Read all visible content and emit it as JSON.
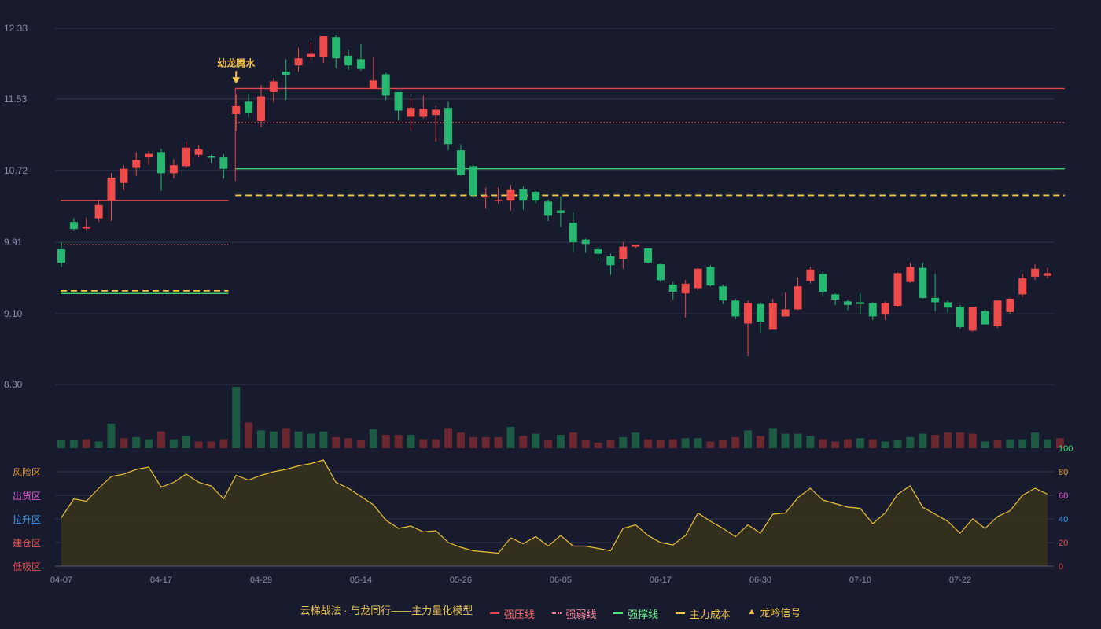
{
  "chart_data": {
    "type": "candlestick",
    "x_ticks": [
      "04-07",
      "04-17",
      "04-29",
      "05-14",
      "05-26",
      "06-05",
      "06-17",
      "06-30",
      "07-10",
      "07-22"
    ],
    "y_ticks": [
      "12.33",
      "11.53",
      "10.72",
      "9.91",
      "9.10",
      "8.30"
    ],
    "ylim": [
      8.3,
      12.33
    ],
    "candles": [
      [
        9.83,
        9.68,
        9.91,
        9.63
      ],
      [
        10.14,
        10.06,
        10.18,
        10.04
      ],
      [
        10.08,
        10.08,
        10.19,
        10.04
      ],
      [
        10.18,
        10.33,
        10.39,
        10.14
      ],
      [
        10.38,
        10.64,
        10.69,
        10.15
      ],
      [
        10.58,
        10.74,
        10.78,
        10.5
      ],
      [
        10.75,
        10.84,
        10.93,
        10.66
      ],
      [
        10.87,
        10.91,
        10.94,
        10.79
      ],
      [
        10.93,
        10.69,
        10.97,
        10.49
      ],
      [
        10.69,
        10.78,
        10.85,
        10.63
      ],
      [
        10.77,
        10.98,
        11.05,
        10.75
      ],
      [
        10.9,
        10.96,
        11.01,
        10.87
      ],
      [
        10.88,
        10.87,
        10.9,
        10.81
      ],
      [
        10.87,
        10.74,
        10.91,
        10.63
      ],
      [
        11.36,
        11.45,
        11.58,
        11.17
      ],
      [
        11.5,
        11.37,
        11.59,
        11.32
      ],
      [
        11.28,
        11.56,
        11.69,
        11.21
      ],
      [
        11.61,
        11.73,
        11.77,
        11.49
      ],
      [
        11.84,
        11.8,
        11.98,
        11.52
      ],
      [
        11.91,
        11.99,
        12.11,
        11.84
      ],
      [
        12.01,
        12.04,
        12.17,
        11.97
      ],
      [
        12.01,
        12.24,
        12.24,
        11.94
      ],
      [
        12.23,
        11.99,
        12.25,
        11.88
      ],
      [
        12.02,
        11.91,
        12.09,
        11.86
      ],
      [
        11.98,
        11.87,
        12.15,
        11.85
      ],
      [
        11.65,
        11.74,
        12.01,
        11.64
      ],
      [
        11.81,
        11.57,
        11.83,
        11.52
      ],
      [
        11.61,
        11.4,
        11.61,
        11.29
      ],
      [
        11.33,
        11.43,
        11.53,
        11.18
      ],
      [
        11.33,
        11.42,
        11.57,
        11.31
      ],
      [
        11.35,
        11.41,
        11.45,
        11.05
      ],
      [
        11.43,
        11.02,
        11.5,
        10.95
      ],
      [
        10.95,
        10.67,
        11.02,
        10.66
      ],
      [
        10.77,
        10.44,
        10.78,
        10.41
      ],
      [
        10.43,
        10.43,
        10.53,
        10.29
      ],
      [
        10.38,
        10.39,
        10.53,
        10.35
      ],
      [
        10.38,
        10.5,
        10.56,
        10.27
      ],
      [
        10.51,
        10.38,
        10.54,
        10.28
      ],
      [
        10.48,
        10.38,
        10.49,
        10.35
      ],
      [
        10.37,
        10.21,
        10.39,
        10.15
      ],
      [
        10.27,
        10.24,
        10.43,
        10.08
      ],
      [
        10.13,
        9.91,
        10.25,
        9.8
      ],
      [
        9.94,
        9.89,
        9.95,
        9.79
      ],
      [
        9.83,
        9.78,
        9.87,
        9.7
      ],
      [
        9.75,
        9.65,
        9.78,
        9.54
      ],
      [
        9.72,
        9.86,
        9.91,
        9.61
      ],
      [
        9.86,
        9.88,
        9.88,
        9.84
      ],
      [
        9.84,
        9.68,
        9.84,
        9.67
      ],
      [
        9.66,
        9.48,
        9.67,
        9.46
      ],
      [
        9.43,
        9.35,
        9.46,
        9.26
      ],
      [
        9.33,
        9.44,
        9.48,
        9.06
      ],
      [
        9.39,
        9.61,
        9.62,
        9.36
      ],
      [
        9.63,
        9.42,
        9.65,
        9.41
      ],
      [
        9.41,
        9.25,
        9.43,
        9.21
      ],
      [
        9.25,
        9.07,
        9.27,
        9.04
      ],
      [
        8.99,
        9.22,
        9.25,
        8.62
      ],
      [
        9.21,
        9.01,
        9.23,
        8.88
      ],
      [
        8.92,
        9.22,
        9.27,
        8.92
      ],
      [
        9.07,
        9.15,
        9.34,
        9.07
      ],
      [
        9.15,
        9.41,
        9.51,
        9.14
      ],
      [
        9.47,
        9.6,
        9.63,
        9.44
      ],
      [
        9.55,
        9.35,
        9.58,
        9.3
      ],
      [
        9.32,
        9.26,
        9.33,
        9.2
      ],
      [
        9.24,
        9.2,
        9.26,
        9.14
      ],
      [
        9.23,
        9.21,
        9.33,
        9.09
      ],
      [
        9.22,
        9.07,
        9.23,
        9.03
      ],
      [
        9.09,
        9.22,
        9.24,
        9.03
      ],
      [
        9.19,
        9.56,
        9.57,
        9.18
      ],
      [
        9.46,
        9.63,
        9.68,
        9.45
      ],
      [
        9.62,
        9.28,
        9.68,
        9.27
      ],
      [
        9.28,
        9.23,
        9.55,
        9.13
      ],
      [
        9.23,
        9.17,
        9.25,
        9.11
      ],
      [
        9.18,
        8.95,
        9.2,
        8.93
      ],
      [
        8.91,
        9.18,
        9.18,
        8.9
      ],
      [
        9.13,
        8.98,
        9.15,
        8.98
      ],
      [
        8.96,
        9.25,
        9.25,
        8.94
      ],
      [
        9.12,
        9.27,
        9.28,
        9.1
      ],
      [
        9.32,
        9.5,
        9.55,
        9.29
      ],
      [
        9.52,
        9.61,
        9.66,
        9.48
      ],
      [
        9.53,
        9.56,
        9.62,
        9.5
      ]
    ],
    "up_color": "#f04b4b",
    "down_color": "#26b870",
    "volume": [
      [
        7,
        false
      ],
      [
        7,
        false
      ],
      [
        8,
        true
      ],
      [
        6,
        false
      ],
      [
        22,
        false
      ],
      [
        9,
        true
      ],
      [
        10,
        false
      ],
      [
        8,
        false
      ],
      [
        15,
        true
      ],
      [
        8,
        false
      ],
      [
        11,
        false
      ],
      [
        6,
        true
      ],
      [
        6,
        true
      ],
      [
        8,
        true
      ],
      [
        55,
        false
      ],
      [
        23,
        true
      ],
      [
        16,
        false
      ],
      [
        15,
        false
      ],
      [
        18,
        true
      ],
      [
        15,
        false
      ],
      [
        13,
        false
      ],
      [
        15,
        false
      ],
      [
        10,
        true
      ],
      [
        9,
        true
      ],
      [
        7,
        true
      ],
      [
        17,
        false
      ],
      [
        12,
        true
      ],
      [
        12,
        true
      ],
      [
        12,
        false
      ],
      [
        8,
        true
      ],
      [
        8,
        true
      ],
      [
        18,
        true
      ],
      [
        14,
        true
      ],
      [
        10,
        true
      ],
      [
        10,
        true
      ],
      [
        10,
        true
      ],
      [
        19,
        false
      ],
      [
        11,
        true
      ],
      [
        13,
        false
      ],
      [
        7,
        true
      ],
      [
        12,
        false
      ],
      [
        14,
        true
      ],
      [
        7,
        true
      ],
      [
        5,
        true
      ],
      [
        7,
        true
      ],
      [
        10,
        false
      ],
      [
        14,
        false
      ],
      [
        8,
        true
      ],
      [
        7,
        true
      ],
      [
        8,
        true
      ],
      [
        9,
        false
      ],
      [
        9,
        false
      ],
      [
        6,
        true
      ],
      [
        7,
        true
      ],
      [
        10,
        true
      ],
      [
        16,
        false
      ],
      [
        11,
        true
      ],
      [
        18,
        false
      ],
      [
        13,
        false
      ],
      [
        13,
        false
      ],
      [
        11,
        false
      ],
      [
        8,
        true
      ],
      [
        6,
        true
      ],
      [
        8,
        true
      ],
      [
        9,
        false
      ],
      [
        8,
        true
      ],
      [
        6,
        false
      ],
      [
        7,
        false
      ],
      [
        10,
        false
      ],
      [
        13,
        false
      ],
      [
        12,
        true
      ],
      [
        14,
        true
      ],
      [
        14,
        true
      ],
      [
        13,
        true
      ],
      [
        6,
        false
      ],
      [
        7,
        true
      ],
      [
        8,
        false
      ],
      [
        8,
        false
      ],
      [
        14,
        false
      ],
      [
        8,
        false
      ],
      [
        9,
        true
      ]
    ],
    "volume_colors": {
      "up": "#6b2830",
      "down": "#1c5a43"
    },
    "lines": [
      {
        "name": "强压线",
        "style": "solid",
        "color": "#e0464f",
        "segments": [
          {
            "from": 0,
            "to": 13,
            "value": 10.38
          },
          {
            "from": 14,
            "to": 80,
            "value": 11.65
          }
        ]
      },
      {
        "name": "强弱线",
        "style": "dotted",
        "color": "#ff7a8a",
        "segments": [
          {
            "from": 0,
            "to": 13,
            "value": 9.88
          },
          {
            "from": 14,
            "to": 80,
            "value": 11.26
          }
        ]
      },
      {
        "name": "强撑线",
        "style": "solid",
        "color": "#4ee37a",
        "segments": [
          {
            "from": 0,
            "to": 13,
            "value": 9.33
          },
          {
            "from": 14,
            "to": 80,
            "value": 10.74
          }
        ]
      },
      {
        "name": "主力成本",
        "style": "dashed",
        "color": "#f2c94c",
        "segments": [
          {
            "from": 0,
            "to": 13,
            "value": 9.36
          },
          {
            "from": 14,
            "to": 80,
            "value": 10.44
          }
        ]
      }
    ],
    "signal": {
      "index": 14,
      "label": "幼龙腾水",
      "color": "#f2c04b"
    },
    "oscillator": {
      "values": [
        41,
        57,
        55,
        66,
        76,
        78,
        82,
        84,
        67,
        71,
        78,
        71,
        68,
        57,
        77,
        73,
        77,
        80,
        82,
        85,
        87,
        90,
        71,
        66,
        59,
        52,
        39,
        32,
        34,
        29,
        30,
        20,
        16,
        13,
        12,
        11,
        24,
        19,
        25,
        17,
        26,
        17,
        17,
        15,
        13,
        32,
        35,
        26,
        20,
        18,
        26,
        45,
        38,
        32,
        25,
        35,
        28,
        44,
        45,
        58,
        66,
        56,
        53,
        50,
        49,
        36,
        45,
        61,
        68,
        50,
        44,
        38,
        28,
        40,
        32,
        42,
        47,
        60,
        66,
        61
      ],
      "ylim": [
        0,
        100
      ],
      "y_ticks": [
        "100",
        "80",
        "60",
        "40",
        "20",
        "0"
      ],
      "tick_colors": [
        "#3de07a",
        "#e6a23c",
        "#e05cd6",
        "#3e9df0",
        "#e0564f",
        "#e04b4b"
      ],
      "zones": [
        {
          "label": "风险区",
          "color": "#e6a23c"
        },
        {
          "label": "出货区",
          "color": "#e05cd6"
        },
        {
          "label": "拉升区",
          "color": "#3e9df0"
        },
        {
          "label": "建仓区",
          "color": "#e0564f"
        },
        {
          "label": "低吸区",
          "color": "#e04b4b"
        }
      ],
      "line_color": "#e8c23a",
      "fill_color": "#36321e"
    },
    "grid": true,
    "legend": {
      "title": "云梯战法 · 与龙同行——主力量化模型",
      "items": [
        {
          "label": "强压线",
          "color": "#e0464f",
          "kind": "solid"
        },
        {
          "label": "强弱线",
          "color": "#ff7a8a",
          "kind": "dotted"
        },
        {
          "label": "强撑线",
          "color": "#4ee37a",
          "kind": "solid"
        },
        {
          "label": "主力成本",
          "color": "#f2c94c",
          "kind": "dashed"
        },
        {
          "label": "龙吟信号",
          "color": "#f2c04b",
          "kind": "triangle"
        }
      ],
      "position": "bottom"
    }
  },
  "colors": {
    "background": "#181a2e",
    "grid": "#34374d",
    "axis_text": "#8c90a8"
  }
}
